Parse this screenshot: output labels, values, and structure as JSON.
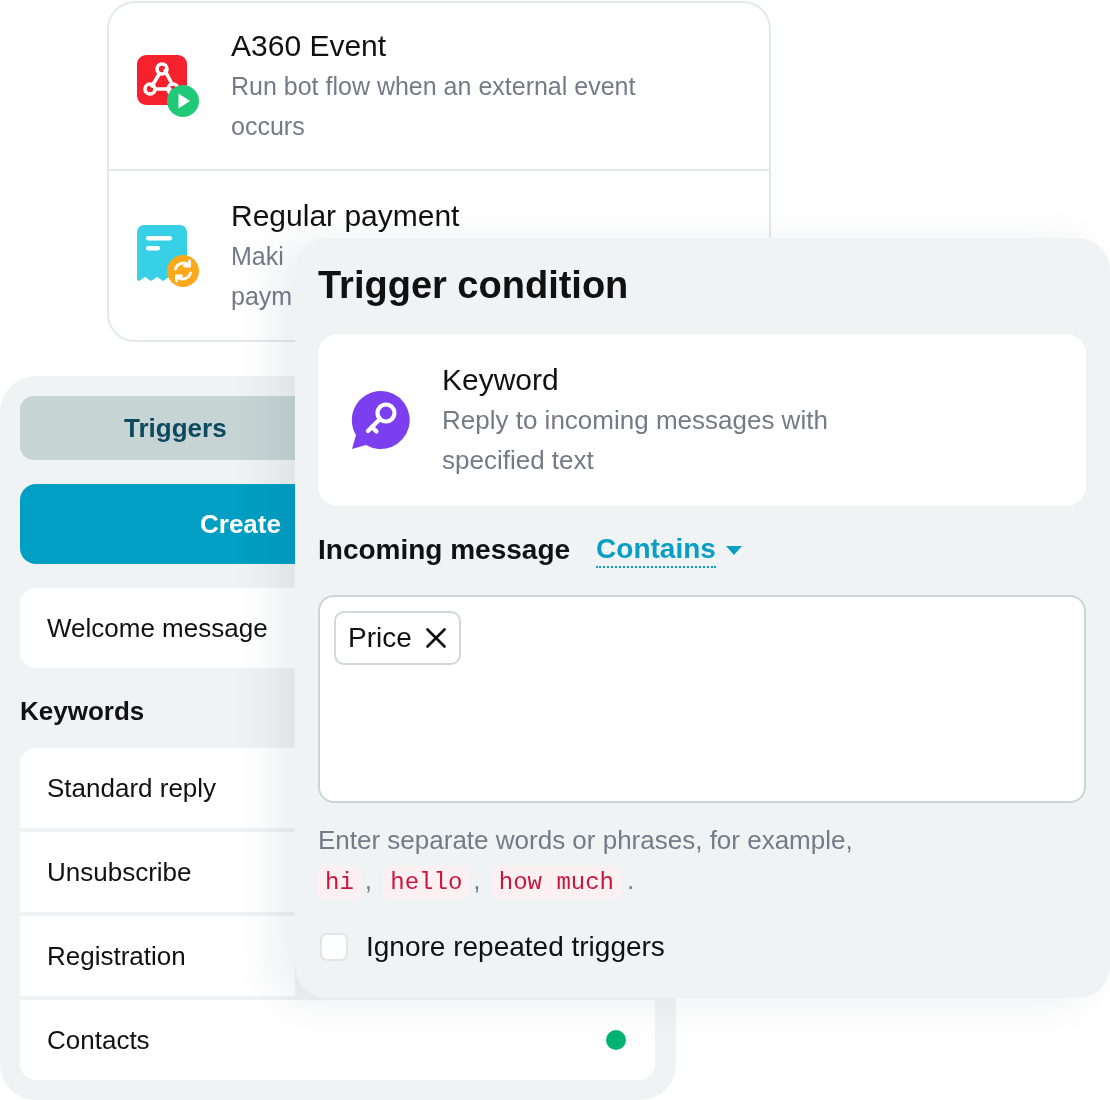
{
  "event_list": {
    "items": [
      {
        "kind": "event",
        "title": "A360 Event",
        "description_lines": [
          "Run bot flow when an external event",
          "occurs"
        ]
      },
      {
        "kind": "payment",
        "title": "Regular payment",
        "description_lines": [
          "Maki",
          "paym"
        ]
      }
    ]
  },
  "sidebar": {
    "tabs": [
      {
        "label": "Triggers",
        "selected": true
      }
    ],
    "create_button": "Create",
    "welcome_item": "Welcome message",
    "keywords_heading": "Keywords",
    "keyword_rows": [
      {
        "label": "Standard reply"
      },
      {
        "label": "Unsubscribe"
      },
      {
        "label": "Registration"
      },
      {
        "label": "Contacts",
        "color": "#00b274"
      }
    ]
  },
  "trigger_condition": {
    "title": "Trigger condition",
    "trigger": {
      "kind": "keyword",
      "title": "Keyword",
      "description_lines": [
        "Reply to incoming messages with",
        "specified text"
      ]
    },
    "incoming_label": "Incoming message",
    "match_mode": "Contains",
    "tags": [
      "Price"
    ],
    "hint": {
      "text": "Enter separate words or phrases, for example,",
      "examples": [
        "hi",
        "hello",
        "how much"
      ],
      "separator": ",",
      "end": "."
    },
    "ignore_repeated": {
      "label": "Ignore repeated triggers",
      "checked": false
    }
  }
}
